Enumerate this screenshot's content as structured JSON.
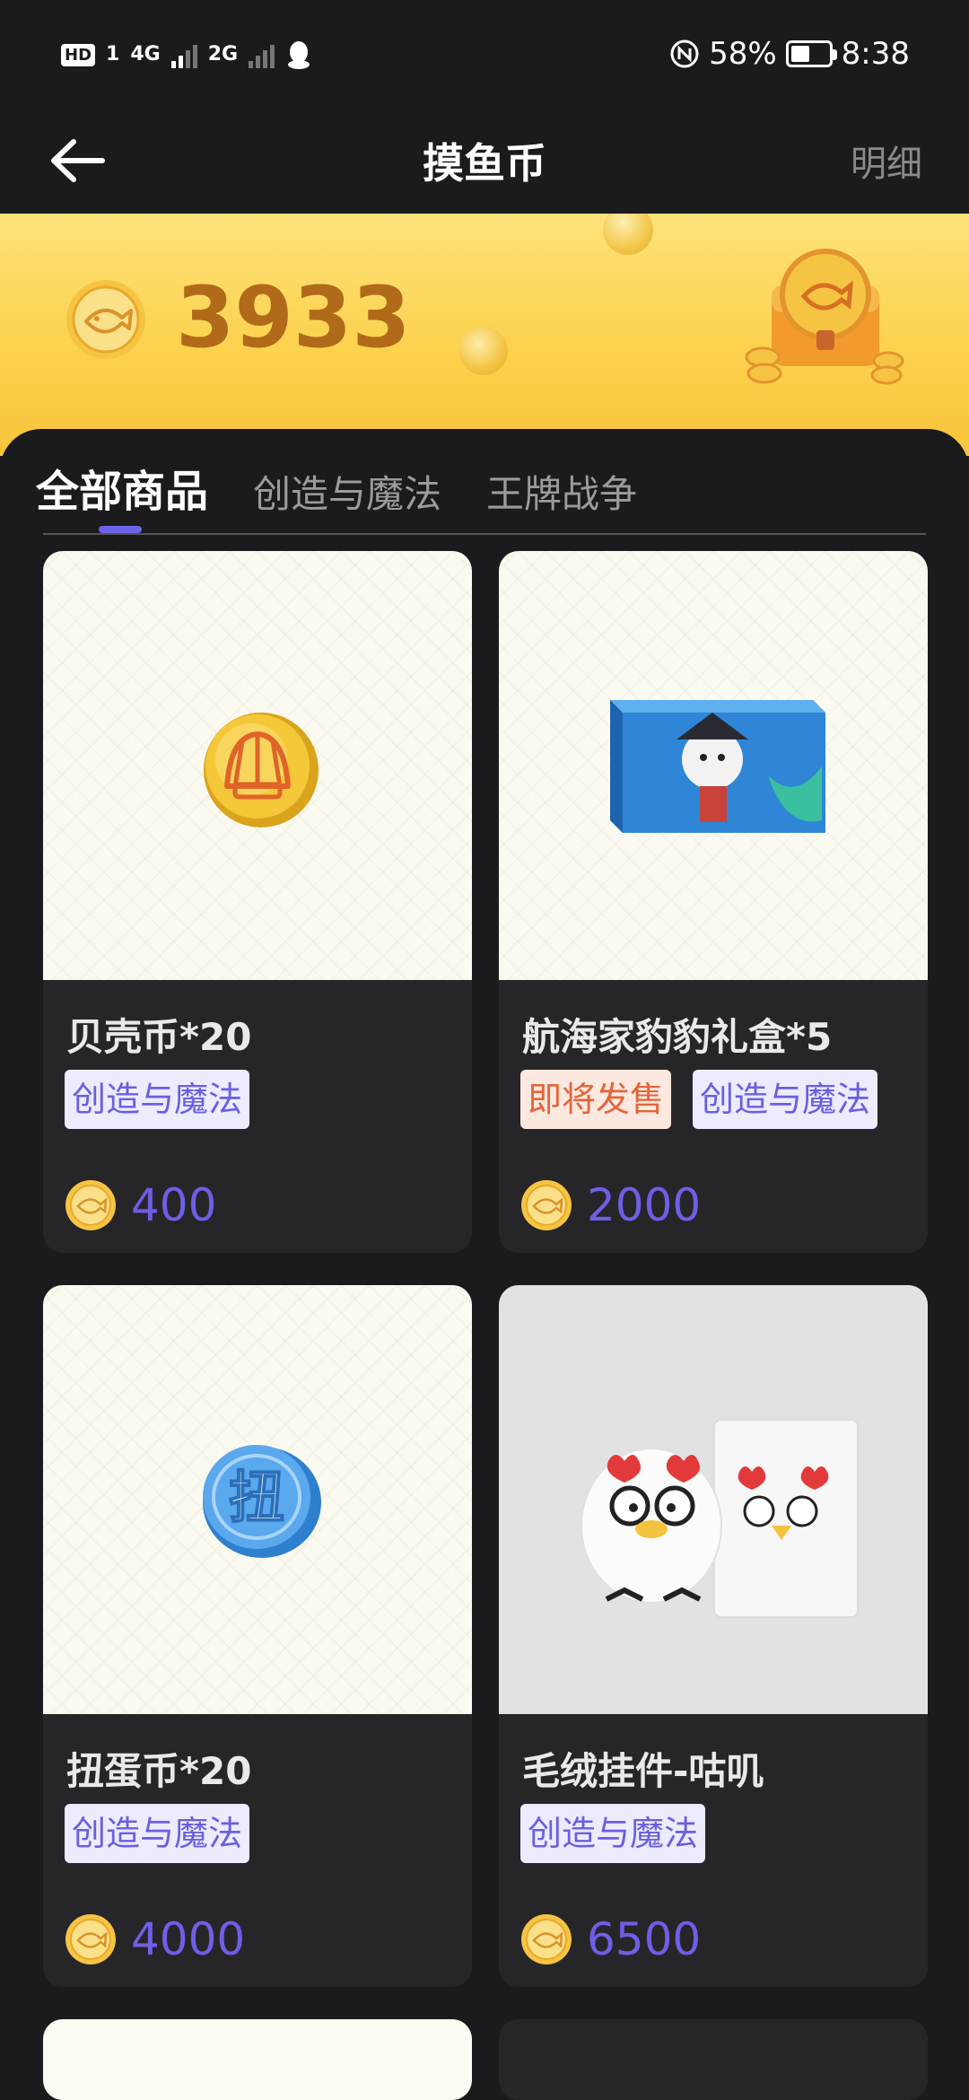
{
  "status_bar": {
    "hd": "HD",
    "sim1": "1",
    "net1": "4G",
    "net2": "2G",
    "battery": "58%",
    "time": "8:38",
    "battery_level": 0.58
  },
  "nav": {
    "title": "摸鱼币",
    "detail_label": "明细"
  },
  "banner": {
    "balance": "3933"
  },
  "tabs": [
    {
      "label": "全部商品",
      "active": true
    },
    {
      "label": "创造与魔法",
      "active": false
    },
    {
      "label": "王牌战争",
      "active": false
    }
  ],
  "products": [
    {
      "name": "贝壳币*20",
      "tags": [
        "创造与魔法"
      ],
      "price": "400",
      "icon": "shell-coin-icon"
    },
    {
      "name": "航海家豹豹礼盒*5",
      "tags": [
        "即将发售",
        "创造与魔法"
      ],
      "price": "2000",
      "icon": "pirate-gift-box-icon"
    },
    {
      "name": "扭蛋币*20",
      "tags": [
        "创造与魔法"
      ],
      "price": "4000",
      "icon": "gacha-coin-icon",
      "icon_text": "扭"
    },
    {
      "name": "毛绒挂件-咕叽",
      "tags": [
        "创造与魔法"
      ],
      "price": "6500",
      "icon": "plush-pendant-icon"
    }
  ],
  "colors": {
    "accent": "#6a62e8",
    "price": "#6e5fe6",
    "tag_purple_bg": "#ecebff",
    "tag_orange_bg": "#fde8df",
    "tag_orange_text": "#e3653a",
    "balance": "#b06a1a"
  }
}
